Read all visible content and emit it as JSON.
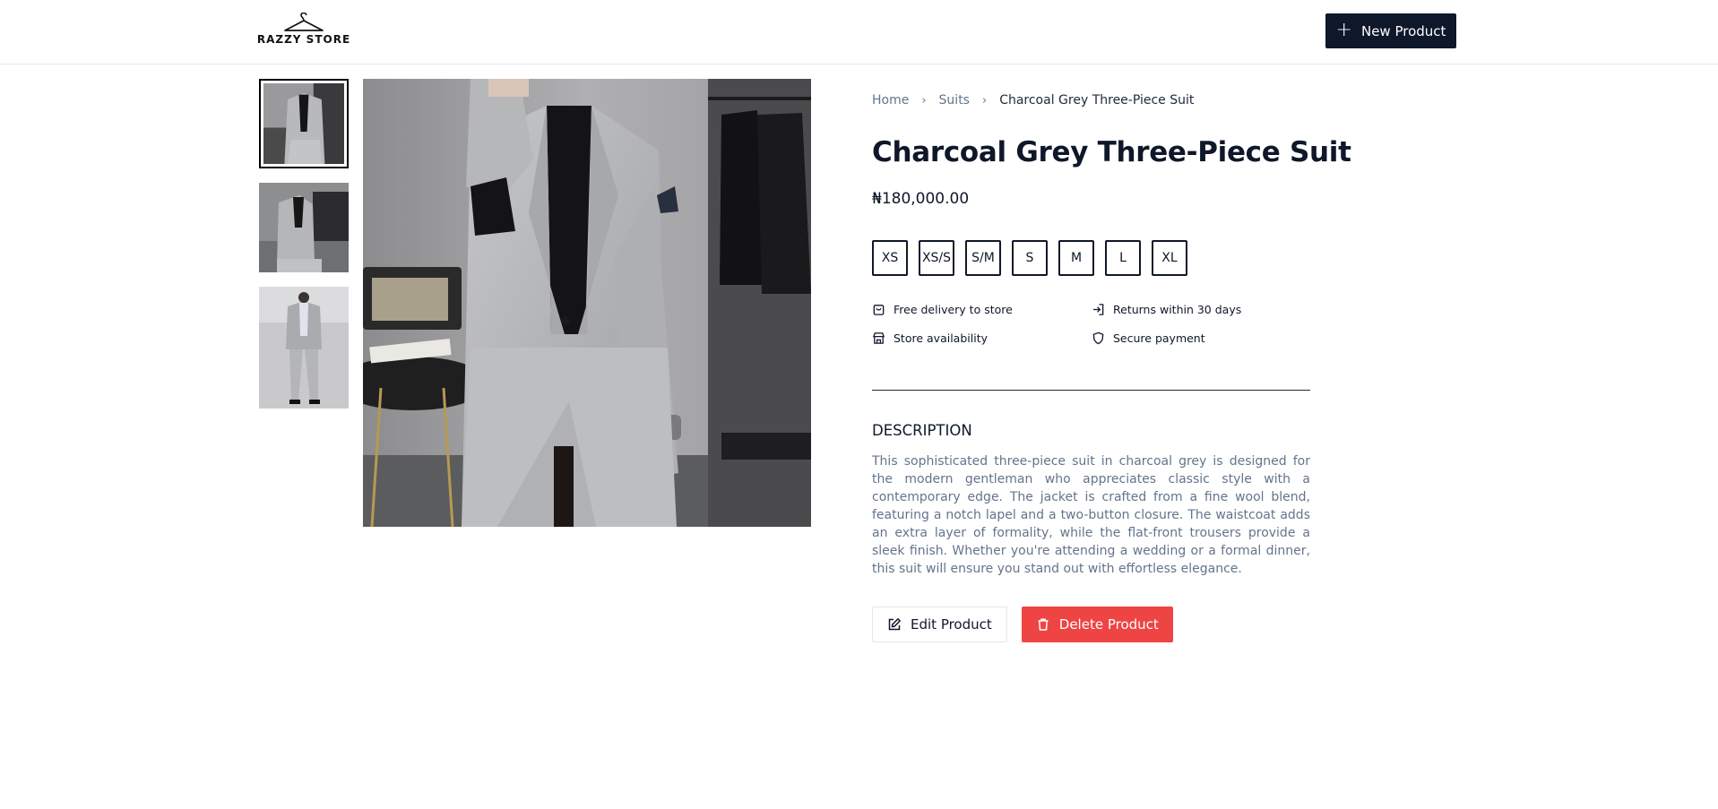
{
  "header": {
    "logo_text": "RAZZY STORE",
    "new_product_label": "New Product"
  },
  "gallery": {
    "thumbnails": [
      {
        "alt": "suit-front-seated"
      },
      {
        "alt": "suit-seated-side"
      },
      {
        "alt": "suit-walking"
      }
    ],
    "active_index": 0
  },
  "breadcrumb": {
    "items": [
      "Home",
      "Suits",
      "Charcoal Grey Three-Piece Suit"
    ]
  },
  "product": {
    "title": "Charcoal Grey Three-Piece Suit",
    "price": "₦180,000.00",
    "sizes": [
      "XS",
      "XS/S",
      "S/M",
      "S",
      "M",
      "L",
      "XL"
    ]
  },
  "features": [
    {
      "icon": "bag-icon",
      "label": "Free delivery to store"
    },
    {
      "icon": "login-arrow-icon",
      "label": "Returns within 30 days"
    },
    {
      "icon": "store-icon",
      "label": "Store availability"
    },
    {
      "icon": "shield-icon",
      "label": "Secure payment"
    }
  ],
  "description": {
    "heading": "DESCRIPTION",
    "text": "This sophisticated three-piece suit in charcoal grey is designed for the modern gentleman who appreciates classic style with a contemporary edge. The jacket is crafted from a fine wool blend, featuring a notch lapel and a two-button closure. The waistcoat adds an extra layer of formality, while the flat-front trousers provide a sleek finish. Whether you're attending a wedding or a formal dinner, this suit will ensure you stand out with effortless elegance."
  },
  "actions": {
    "edit_label": "Edit Product",
    "delete_label": "Delete Product"
  },
  "colors": {
    "primary": "#0f172a",
    "danger": "#ef4444",
    "muted_text": "#64748b"
  }
}
